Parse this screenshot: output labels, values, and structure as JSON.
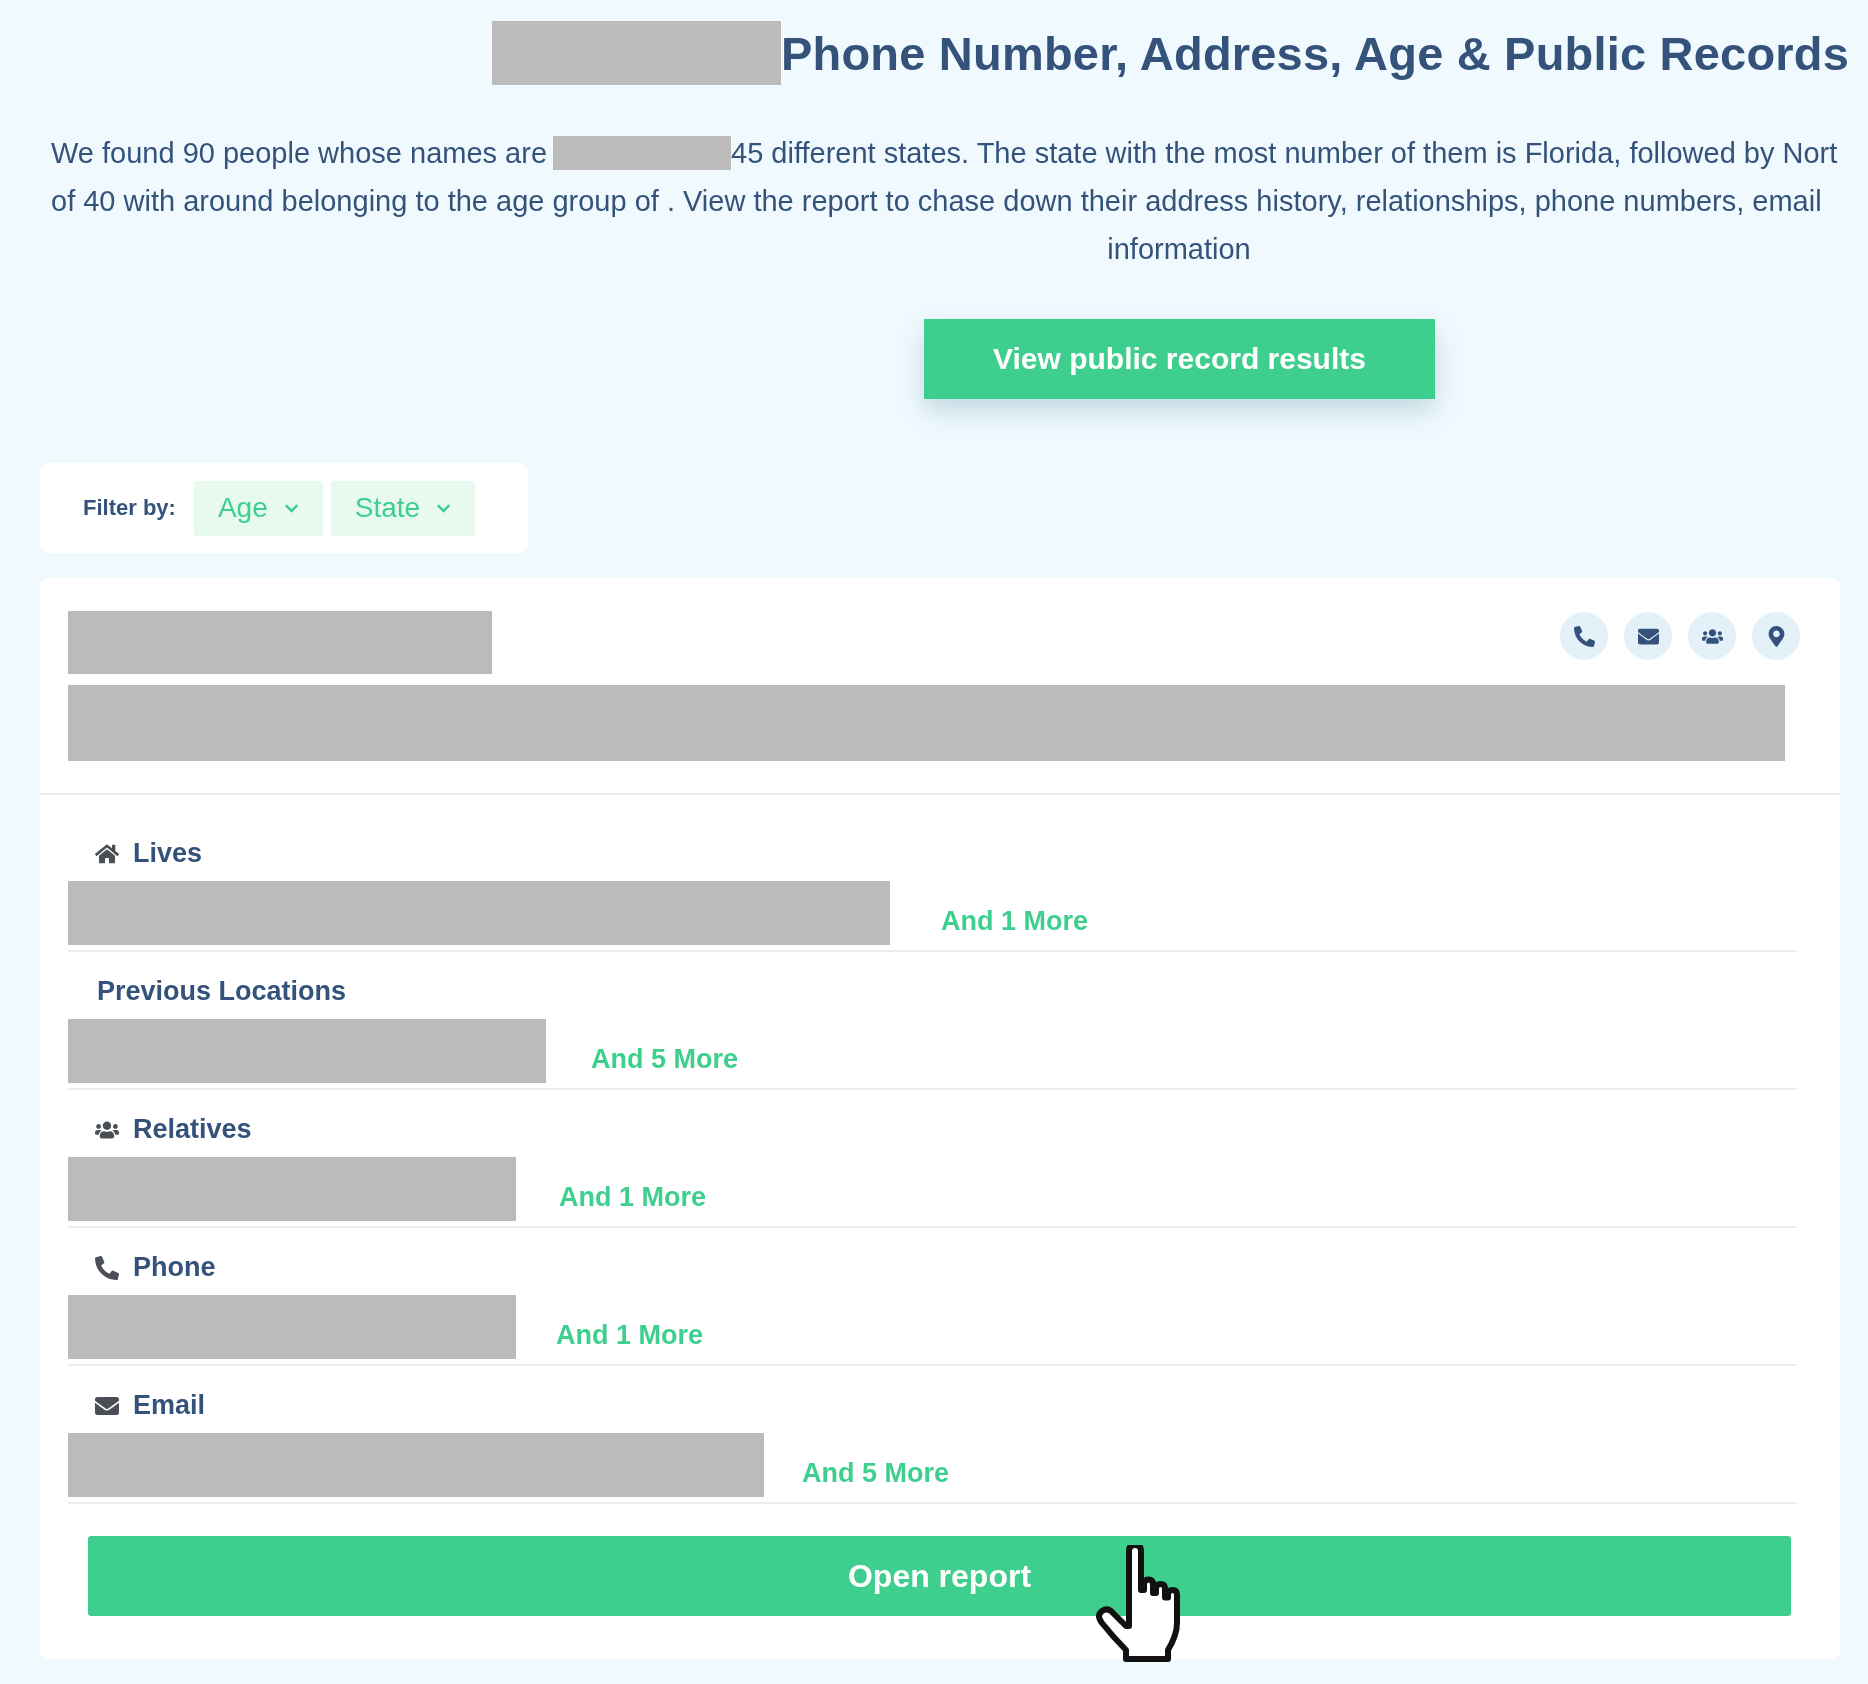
{
  "heading": {
    "title": "Phone Number, Address, Age & Public Records"
  },
  "summary": {
    "line_1_start": "We found 90 people whose names are",
    "line_1_end": "45 different states. The state with the most number of them is Florida, followed by Nort",
    "line_2": "of 40 with around belonging to the age group of . View the report to chase down their address history, relationships, phone numbers, email",
    "line_3": "information"
  },
  "cta_button": "View public record results",
  "filter": {
    "label": "Filter by:",
    "options": [
      {
        "label": "Age"
      },
      {
        "label": "State"
      }
    ]
  },
  "result": {
    "sections": [
      {
        "kind": "lives",
        "label": "Lives",
        "more": "And 1 More"
      },
      {
        "kind": "previous",
        "label": "Previous Locations",
        "more": "And 5 More"
      },
      {
        "kind": "relatives",
        "label": "Relatives",
        "more": "And 1 More"
      },
      {
        "kind": "phone",
        "label": "Phone",
        "more": "And 1 More"
      },
      {
        "kind": "email",
        "label": "Email",
        "more": "And 5 More"
      }
    ],
    "open_report_button": "Open report"
  }
}
